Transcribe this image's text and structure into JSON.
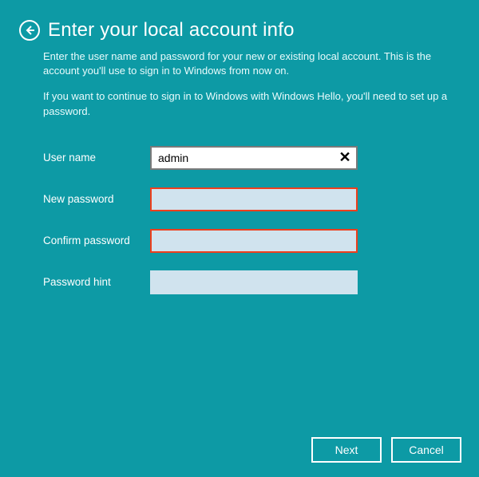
{
  "header": {
    "title": "Enter your local account info"
  },
  "description": {
    "p1": "Enter the user name and password for your new or existing local account. This is the account you'll use to sign in to Windows from now on.",
    "p2": "If you want to continue to sign in to Windows with Windows Hello, you'll need to set up a password."
  },
  "fields": {
    "username": {
      "label": "User name",
      "value": "admin"
    },
    "new_password": {
      "label": "New password",
      "value": ""
    },
    "confirm_password": {
      "label": "Confirm password",
      "value": ""
    },
    "password_hint": {
      "label": "Password hint",
      "value": ""
    }
  },
  "buttons": {
    "next": "Next",
    "cancel": "Cancel"
  }
}
